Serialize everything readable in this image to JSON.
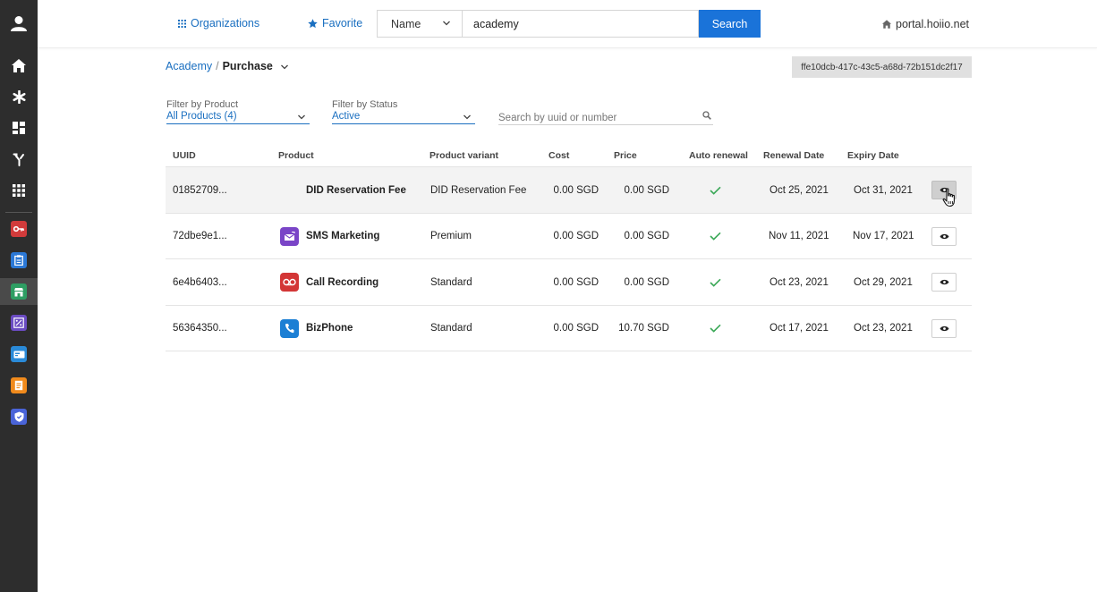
{
  "sidebar": {
    "items": [
      {
        "icon": "user-icon"
      },
      {
        "icon": "home-icon"
      },
      {
        "icon": "asterisk-icon"
      },
      {
        "icon": "dashboard-icon"
      },
      {
        "icon": "fork-icon"
      },
      {
        "icon": "apps-grid-icon"
      }
    ],
    "apps": [
      {
        "icon": "key-app-icon",
        "color": "#d13b3b"
      },
      {
        "icon": "clipboard-app-icon",
        "color": "#2b78d6"
      },
      {
        "icon": "store-app-icon",
        "color": "#2e9e63"
      },
      {
        "icon": "percent-app-icon",
        "color": "#6b4cc2"
      },
      {
        "icon": "card-app-icon",
        "color": "#2a8ad8"
      },
      {
        "icon": "doc-app-icon",
        "color": "#f08a1c"
      },
      {
        "icon": "shield-app-icon",
        "color": "#4a64d8"
      }
    ]
  },
  "topbar": {
    "organizations_label": "Organizations",
    "favorite_label": "Favorite",
    "name_select_value": "Name",
    "search_value": "academy",
    "search_button": "Search",
    "portal": "portal.hoiio.net"
  },
  "breadcrumb": {
    "parent": "Academy",
    "separator": "/",
    "current": "Purchase"
  },
  "uuid_badge": "ffe10dcb-417c-43c5-a68d-72b151dc2f17",
  "filters": {
    "product": {
      "label": "Filter by Product",
      "value": "All Products (4)"
    },
    "status": {
      "label": "Filter by Status",
      "value": "Active"
    },
    "search_placeholder": "Search by uuid or number"
  },
  "table": {
    "headers": {
      "uuid": "UUID",
      "product": "Product",
      "variant": "Product variant",
      "cost": "Cost",
      "price": "Price",
      "auto_renewal": "Auto renewal",
      "renewal_date": "Renewal Date",
      "expiry_date": "Expiry Date"
    },
    "rows": [
      {
        "uuid": "01852709...",
        "product": "DID Reservation Fee",
        "icon": "none",
        "variant": "DID Reservation Fee",
        "cost": "0.00 SGD",
        "price": "0.00 SGD",
        "auto_renewal": true,
        "renewal_date": "Oct 25, 2021",
        "expiry_date": "Oct 31, 2021"
      },
      {
        "uuid": "72dbe9e1...",
        "product": "SMS Marketing",
        "icon": "sms-marketing-icon",
        "icon_color": "#7a45c7",
        "variant": "Premium",
        "cost": "0.00 SGD",
        "price": "0.00 SGD",
        "auto_renewal": true,
        "renewal_date": "Nov 11, 2021",
        "expiry_date": "Nov 17, 2021"
      },
      {
        "uuid": "6e4b6403...",
        "product": "Call Recording",
        "icon": "call-recording-icon",
        "icon_color": "#d33636",
        "variant": "Standard",
        "cost": "0.00 SGD",
        "price": "0.00 SGD",
        "auto_renewal": true,
        "renewal_date": "Oct 23, 2021",
        "expiry_date": "Oct 29, 2021"
      },
      {
        "uuid": "56364350...",
        "product": "BizPhone",
        "icon": "bizphone-icon",
        "icon_color": "#1c7fd4",
        "variant": "Standard",
        "cost": "0.00 SGD",
        "price": "10.70 SGD",
        "auto_renewal": true,
        "renewal_date": "Oct 17, 2021",
        "expiry_date": "Oct 23, 2021"
      }
    ]
  }
}
